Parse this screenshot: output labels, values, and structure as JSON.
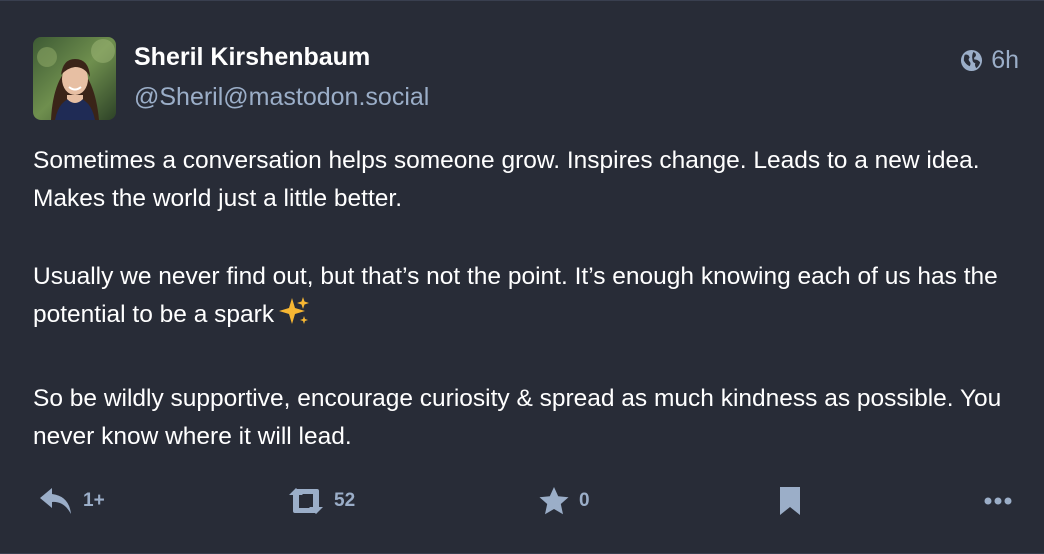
{
  "author": {
    "display_name": "Sheril Kirshenbaum",
    "handle": "@Sheril@mastodon.social"
  },
  "meta": {
    "visibility_icon": "globe-icon",
    "time": "6h"
  },
  "content": {
    "paragraphs": [
      "Sometimes a conversation helps someone grow. Inspires change. Leads to a new idea. Makes the world just a little better.",
      "Usually we never find out, but that’s not the point. It’s enough knowing each of us has the potential to be a spark",
      "So be wildly supportive, encourage curiosity & spread as much kindness as possible. You never know where it will lead."
    ],
    "emoji": "sparkles-emoji"
  },
  "actions": {
    "reply_count": "1+",
    "boost_count": "52",
    "favourite_count": "0"
  },
  "colors": {
    "background": "#282c37",
    "muted_text": "#9baec8",
    "sparkle": "#f7b733"
  }
}
